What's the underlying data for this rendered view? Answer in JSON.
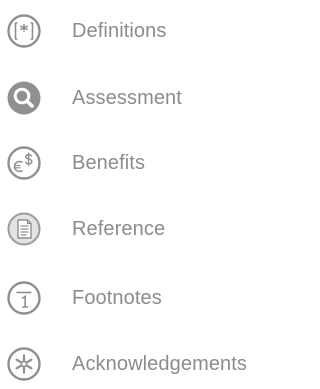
{
  "nav": {
    "items": [
      {
        "label": "Definitions",
        "icon": "definitions-bracket-asterisk-icon"
      },
      {
        "label": "Assessment",
        "icon": "magnifier-icon"
      },
      {
        "label": "Benefits",
        "icon": "euro-dollar-icon"
      },
      {
        "label": "Reference",
        "icon": "document-icon"
      },
      {
        "label": "Footnotes",
        "icon": "footnote-one-icon"
      },
      {
        "label": "Acknowledgements",
        "icon": "asterisk-icon"
      }
    ]
  },
  "colors": {
    "icon_stroke": "#8f8f8f",
    "icon_fill_light": "#e3e3e3",
    "label_text": "#8c8c8c"
  }
}
